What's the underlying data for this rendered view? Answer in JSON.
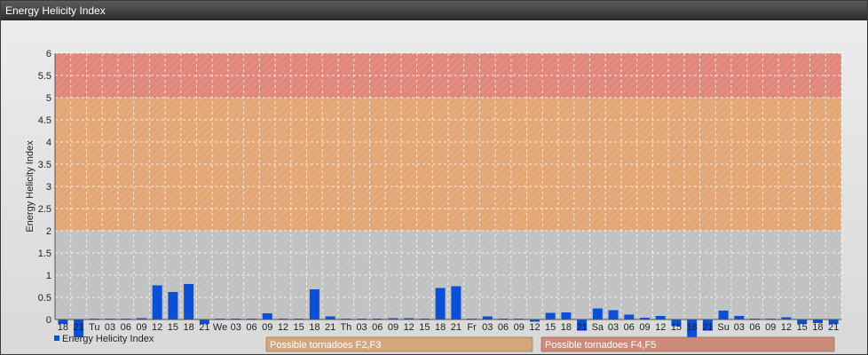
{
  "window": {
    "title": "Energy Helicity Index"
  },
  "chart_data": {
    "type": "bar",
    "ylabel": "Energy Helicity Index",
    "ylim": [
      0,
      6
    ],
    "yticks": [
      "0",
      "0.5",
      "1",
      "1.5",
      "2",
      "2.5",
      "3",
      "3.5",
      "4",
      "4.5",
      "5",
      "5.5",
      "6"
    ],
    "grid": true,
    "legend": {
      "position": "bottom-left",
      "label": "Energy Helicity Index",
      "color": "#0b4fd6"
    },
    "bands": [
      {
        "from": 0,
        "to": 2,
        "color": "#bfc1c3"
      },
      {
        "from": 2,
        "to": 5,
        "color": "#e3a776"
      },
      {
        "from": 5,
        "to": 6,
        "color": "#e0867a"
      }
    ],
    "annotations": [
      {
        "label": "Possible tornadoes F2,F3",
        "color": "#d4a67e"
      },
      {
        "label": "Possible tornadoes F4,F5",
        "color": "#cc8a78"
      }
    ],
    "categories": [
      "18",
      "21",
      "Tu",
      "03",
      "06",
      "09",
      "12",
      "15",
      "18",
      "21",
      "We",
      "03",
      "06",
      "09",
      "12",
      "15",
      "18",
      "21",
      "Th",
      "03",
      "06",
      "09",
      "12",
      "15",
      "18",
      "21",
      "Fr",
      "03",
      "06",
      "09",
      "12",
      "15",
      "18",
      "21",
      "Sa",
      "03",
      "06",
      "09",
      "12",
      "15",
      "18",
      "21",
      "Su",
      "03",
      "06",
      "09",
      "12",
      "15",
      "18",
      "21"
    ],
    "series": [
      {
        "name": "Energy Helicity Index",
        "color": "#0b4fd6",
        "values": [
          -0.1,
          -0.4,
          0.02,
          0.02,
          0.02,
          0.03,
          0.77,
          0.62,
          0.8,
          -0.1,
          0.02,
          0.02,
          0.02,
          0.14,
          0.02,
          0.02,
          0.68,
          0.07,
          0.02,
          0.02,
          0.02,
          0.03,
          0.03,
          0.02,
          0.71,
          0.75,
          0.02,
          0.07,
          0.02,
          0.02,
          -0.05,
          0.15,
          0.16,
          -0.25,
          0.25,
          0.21,
          0.11,
          0.04,
          0.08,
          -0.15,
          -0.42,
          -0.25,
          0.2,
          0.08,
          0.02,
          0.02,
          0.05,
          -0.1,
          -0.08,
          -0.1
        ]
      }
    ]
  }
}
